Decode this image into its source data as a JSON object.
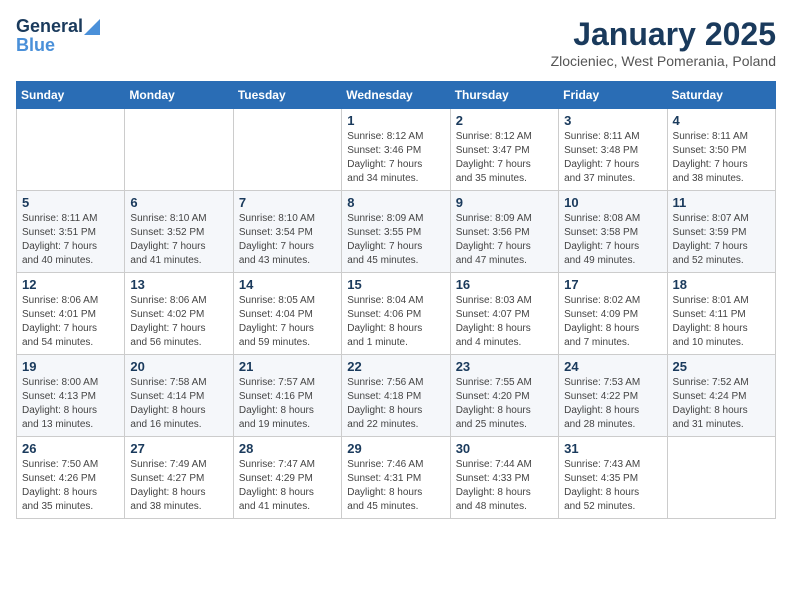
{
  "header": {
    "logo_line1": "General",
    "logo_line2": "Blue",
    "title": "January 2025",
    "subtitle": "Zlocieniec, West Pomerania, Poland"
  },
  "weekdays": [
    "Sunday",
    "Monday",
    "Tuesday",
    "Wednesday",
    "Thursday",
    "Friday",
    "Saturday"
  ],
  "weeks": [
    [
      {
        "day": "",
        "info": ""
      },
      {
        "day": "",
        "info": ""
      },
      {
        "day": "",
        "info": ""
      },
      {
        "day": "1",
        "info": "Sunrise: 8:12 AM\nSunset: 3:46 PM\nDaylight: 7 hours\nand 34 minutes."
      },
      {
        "day": "2",
        "info": "Sunrise: 8:12 AM\nSunset: 3:47 PM\nDaylight: 7 hours\nand 35 minutes."
      },
      {
        "day": "3",
        "info": "Sunrise: 8:11 AM\nSunset: 3:48 PM\nDaylight: 7 hours\nand 37 minutes."
      },
      {
        "day": "4",
        "info": "Sunrise: 8:11 AM\nSunset: 3:50 PM\nDaylight: 7 hours\nand 38 minutes."
      }
    ],
    [
      {
        "day": "5",
        "info": "Sunrise: 8:11 AM\nSunset: 3:51 PM\nDaylight: 7 hours\nand 40 minutes."
      },
      {
        "day": "6",
        "info": "Sunrise: 8:10 AM\nSunset: 3:52 PM\nDaylight: 7 hours\nand 41 minutes."
      },
      {
        "day": "7",
        "info": "Sunrise: 8:10 AM\nSunset: 3:54 PM\nDaylight: 7 hours\nand 43 minutes."
      },
      {
        "day": "8",
        "info": "Sunrise: 8:09 AM\nSunset: 3:55 PM\nDaylight: 7 hours\nand 45 minutes."
      },
      {
        "day": "9",
        "info": "Sunrise: 8:09 AM\nSunset: 3:56 PM\nDaylight: 7 hours\nand 47 minutes."
      },
      {
        "day": "10",
        "info": "Sunrise: 8:08 AM\nSunset: 3:58 PM\nDaylight: 7 hours\nand 49 minutes."
      },
      {
        "day": "11",
        "info": "Sunrise: 8:07 AM\nSunset: 3:59 PM\nDaylight: 7 hours\nand 52 minutes."
      }
    ],
    [
      {
        "day": "12",
        "info": "Sunrise: 8:06 AM\nSunset: 4:01 PM\nDaylight: 7 hours\nand 54 minutes."
      },
      {
        "day": "13",
        "info": "Sunrise: 8:06 AM\nSunset: 4:02 PM\nDaylight: 7 hours\nand 56 minutes."
      },
      {
        "day": "14",
        "info": "Sunrise: 8:05 AM\nSunset: 4:04 PM\nDaylight: 7 hours\nand 59 minutes."
      },
      {
        "day": "15",
        "info": "Sunrise: 8:04 AM\nSunset: 4:06 PM\nDaylight: 8 hours\nand 1 minute."
      },
      {
        "day": "16",
        "info": "Sunrise: 8:03 AM\nSunset: 4:07 PM\nDaylight: 8 hours\nand 4 minutes."
      },
      {
        "day": "17",
        "info": "Sunrise: 8:02 AM\nSunset: 4:09 PM\nDaylight: 8 hours\nand 7 minutes."
      },
      {
        "day": "18",
        "info": "Sunrise: 8:01 AM\nSunset: 4:11 PM\nDaylight: 8 hours\nand 10 minutes."
      }
    ],
    [
      {
        "day": "19",
        "info": "Sunrise: 8:00 AM\nSunset: 4:13 PM\nDaylight: 8 hours\nand 13 minutes."
      },
      {
        "day": "20",
        "info": "Sunrise: 7:58 AM\nSunset: 4:14 PM\nDaylight: 8 hours\nand 16 minutes."
      },
      {
        "day": "21",
        "info": "Sunrise: 7:57 AM\nSunset: 4:16 PM\nDaylight: 8 hours\nand 19 minutes."
      },
      {
        "day": "22",
        "info": "Sunrise: 7:56 AM\nSunset: 4:18 PM\nDaylight: 8 hours\nand 22 minutes."
      },
      {
        "day": "23",
        "info": "Sunrise: 7:55 AM\nSunset: 4:20 PM\nDaylight: 8 hours\nand 25 minutes."
      },
      {
        "day": "24",
        "info": "Sunrise: 7:53 AM\nSunset: 4:22 PM\nDaylight: 8 hours\nand 28 minutes."
      },
      {
        "day": "25",
        "info": "Sunrise: 7:52 AM\nSunset: 4:24 PM\nDaylight: 8 hours\nand 31 minutes."
      }
    ],
    [
      {
        "day": "26",
        "info": "Sunrise: 7:50 AM\nSunset: 4:26 PM\nDaylight: 8 hours\nand 35 minutes."
      },
      {
        "day": "27",
        "info": "Sunrise: 7:49 AM\nSunset: 4:27 PM\nDaylight: 8 hours\nand 38 minutes."
      },
      {
        "day": "28",
        "info": "Sunrise: 7:47 AM\nSunset: 4:29 PM\nDaylight: 8 hours\nand 41 minutes."
      },
      {
        "day": "29",
        "info": "Sunrise: 7:46 AM\nSunset: 4:31 PM\nDaylight: 8 hours\nand 45 minutes."
      },
      {
        "day": "30",
        "info": "Sunrise: 7:44 AM\nSunset: 4:33 PM\nDaylight: 8 hours\nand 48 minutes."
      },
      {
        "day": "31",
        "info": "Sunrise: 7:43 AM\nSunset: 4:35 PM\nDaylight: 8 hours\nand 52 minutes."
      },
      {
        "day": "",
        "info": ""
      }
    ]
  ]
}
